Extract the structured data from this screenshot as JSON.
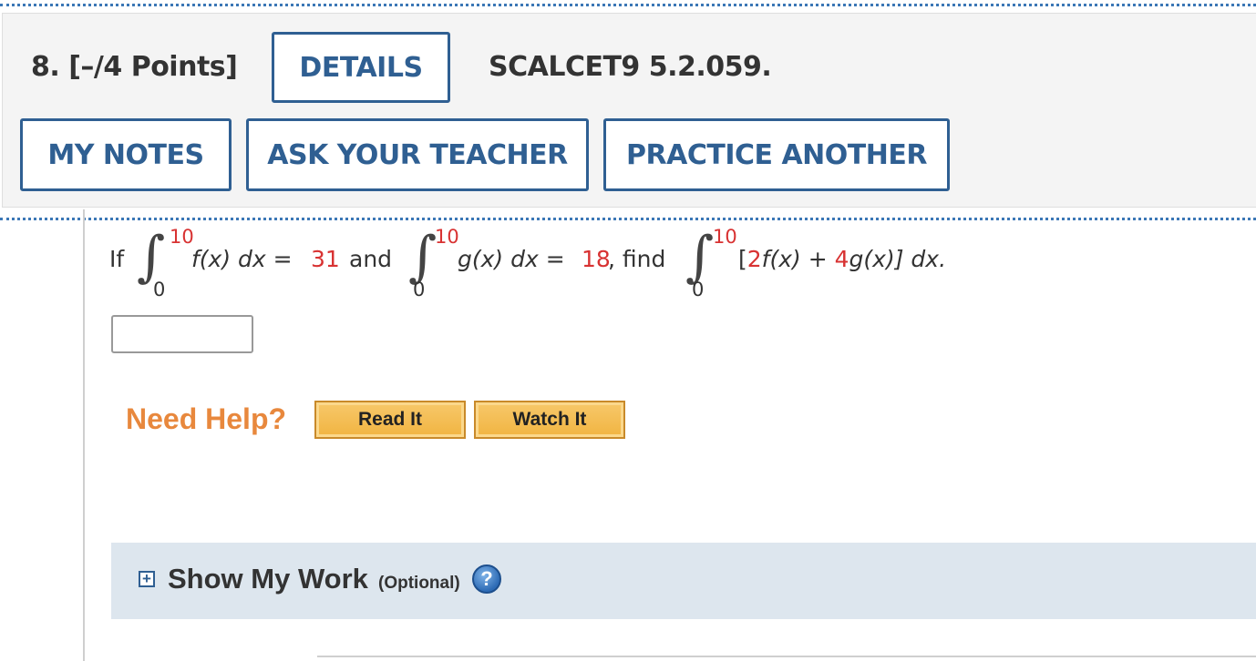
{
  "question": {
    "number_points": "8.  [–/4 Points]",
    "details_label": "DETAILS",
    "reference": "SCALCET9 5.2.059."
  },
  "actions": {
    "my_notes": "MY NOTES",
    "ask_teacher": "ASK YOUR TEACHER",
    "practice_another": "PRACTICE ANOTHER"
  },
  "problem": {
    "if_word": "If",
    "int1_upper": "10",
    "int1_lower": "0",
    "int1_body": "f(x) dx =",
    "value1": "31",
    "and_word": "and",
    "int2_upper": "10",
    "int2_lower": "0",
    "int2_body": "g(x) dx =",
    "value2": "18",
    "find_word": ", find",
    "int3_upper": "10",
    "int3_lower": "0",
    "int3_open": "[",
    "coef1": "2",
    "int3_mid": "f(x) +",
    "coef2": "4",
    "int3_end": "g(x)] dx."
  },
  "answer": {
    "value": ""
  },
  "help": {
    "label": "Need Help?",
    "read_it": "Read It",
    "watch_it": "Watch It"
  },
  "work": {
    "expand_symbol": "+",
    "title": "Show My Work",
    "optional": "(Optional)",
    "help_symbol": "?"
  },
  "colors": {
    "accent": "#2f5f92",
    "highlight_red": "#d83232",
    "need_help": "#e8883d",
    "work_panel": "#dde6ee"
  }
}
